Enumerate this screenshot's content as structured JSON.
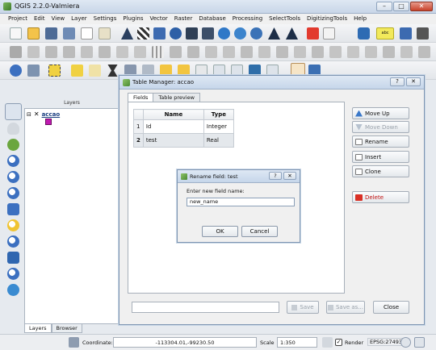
{
  "window": {
    "title": "QGIS 2.2.0-Valmiera",
    "buttons": [
      "–",
      "□",
      "✕"
    ]
  },
  "menu": [
    "Project",
    "Edit",
    "View",
    "Layer",
    "Settings",
    "Plugins",
    "Vector",
    "Raster",
    "Database",
    "Processing",
    "SelectTools",
    "DigitizingTools",
    "Help"
  ],
  "toolbar": {
    "abc_label": "abc"
  },
  "layers_panel": {
    "header": "Layers",
    "layer_name": "accao",
    "layer_color": "#c01ab0",
    "tabs": [
      "Layers",
      "Browser"
    ]
  },
  "table_manager": {
    "title": "Table Manager: accao",
    "help_btn": "?",
    "close_btn": "✕",
    "tabs": [
      "Fields",
      "Table preview"
    ],
    "columns": [
      "Name",
      "Type"
    ],
    "rows": [
      {
        "num": "1",
        "name": "Id",
        "type": "Integer"
      },
      {
        "num": "2",
        "name": "test",
        "type": "Real"
      }
    ],
    "side_buttons": {
      "move_up": "Move Up",
      "move_down": "Move Down",
      "rename": "Rename",
      "insert": "Insert",
      "clone": "Clone",
      "delete": "Delete"
    },
    "bottom": {
      "save": "Save",
      "save_as": "Save as...",
      "close": "Close"
    }
  },
  "rename_dialog": {
    "title": "Rename field: test",
    "help_btn": "?",
    "close_btn": "✕",
    "label": "Enter new field name:",
    "value": "new_name",
    "ok": "OK",
    "cancel": "Cancel"
  },
  "statusbar": {
    "coordinate_label": "Coordinate:",
    "coordinate_value": "-113304.01,-99230.50",
    "scale_label": "Scale",
    "scale_value": "1:350",
    "render_label": "Render",
    "crs": "EPSG:27493"
  }
}
